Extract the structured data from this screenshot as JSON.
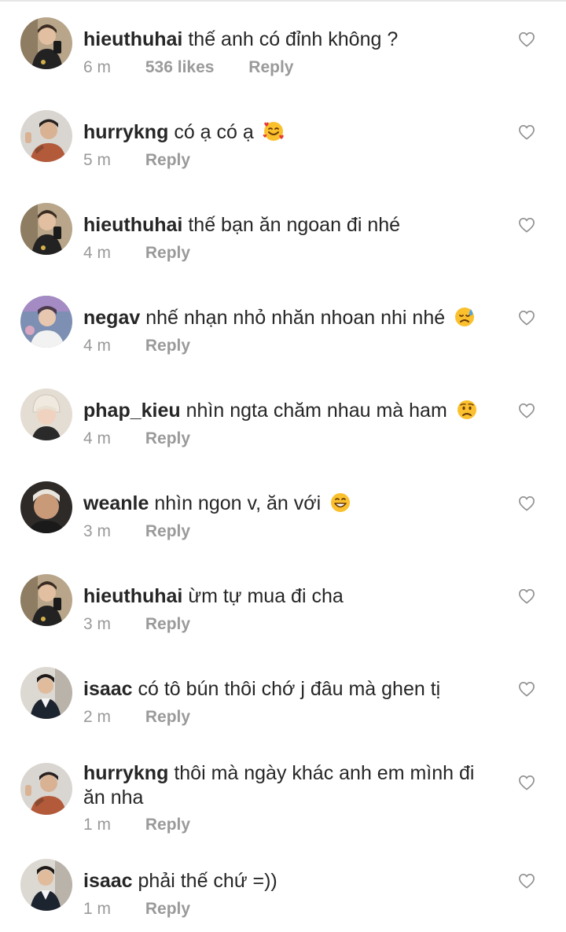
{
  "comments": [
    {
      "username": "hieuthuhai",
      "text": "thế anh có đỉnh không ?",
      "time": "6 m",
      "likes": "536 likes",
      "reply": "Reply",
      "emoji": "",
      "avatar": "hieuthuhai"
    },
    {
      "username": "hurrykng",
      "text": "có ạ có ạ",
      "time": "5 m",
      "likes": "",
      "reply": "Reply",
      "emoji": "smiling-face-with-hearts",
      "avatar": "hurrykng"
    },
    {
      "username": "hieuthuhai",
      "text": "thế bạn ăn ngoan đi nhé",
      "time": "4 m",
      "likes": "",
      "reply": "Reply",
      "emoji": "",
      "avatar": "hieuthuhai"
    },
    {
      "username": "negav",
      "text": "nhế nhạn nhỏ nhăn nhoan nhi nhé",
      "time": "4 m",
      "likes": "",
      "reply": "Reply",
      "emoji": "sad-sweat-face",
      "avatar": "negav"
    },
    {
      "username": "phap_kieu",
      "text": "nhìn ngta chăm nhau mà ham",
      "time": "4 m",
      "likes": "",
      "reply": "Reply",
      "emoji": "worried-face",
      "avatar": "phap_kieu"
    },
    {
      "username": "weanle",
      "text": "nhìn ngon v, ăn với",
      "time": "3 m",
      "likes": "",
      "reply": "Reply",
      "emoji": "grinning-face",
      "avatar": "weanle"
    },
    {
      "username": "hieuthuhai",
      "text": "ừm tự mua đi cha",
      "time": "3 m",
      "likes": "",
      "reply": "Reply",
      "emoji": "",
      "avatar": "hieuthuhai"
    },
    {
      "username": "isaac",
      "text": "có tô bún thôi chớ j đâu mà ghen tị",
      "time": "2 m",
      "likes": "",
      "reply": "Reply",
      "emoji": "",
      "avatar": "isaac"
    },
    {
      "username": "hurrykng",
      "text": "thôi mà ngày khác anh em mình đi ăn nha",
      "time": "1 m",
      "likes": "",
      "reply": "Reply",
      "emoji": "",
      "avatar": "hurrykng"
    },
    {
      "username": "isaac",
      "text": "phải thế chứ =))",
      "time": "1 m",
      "likes": "",
      "reply": "Reply",
      "emoji": "",
      "avatar": "isaac"
    }
  ],
  "colors": {
    "text": "#262626",
    "meta": "#9a9a9a",
    "heart": "#8e8e8e"
  }
}
